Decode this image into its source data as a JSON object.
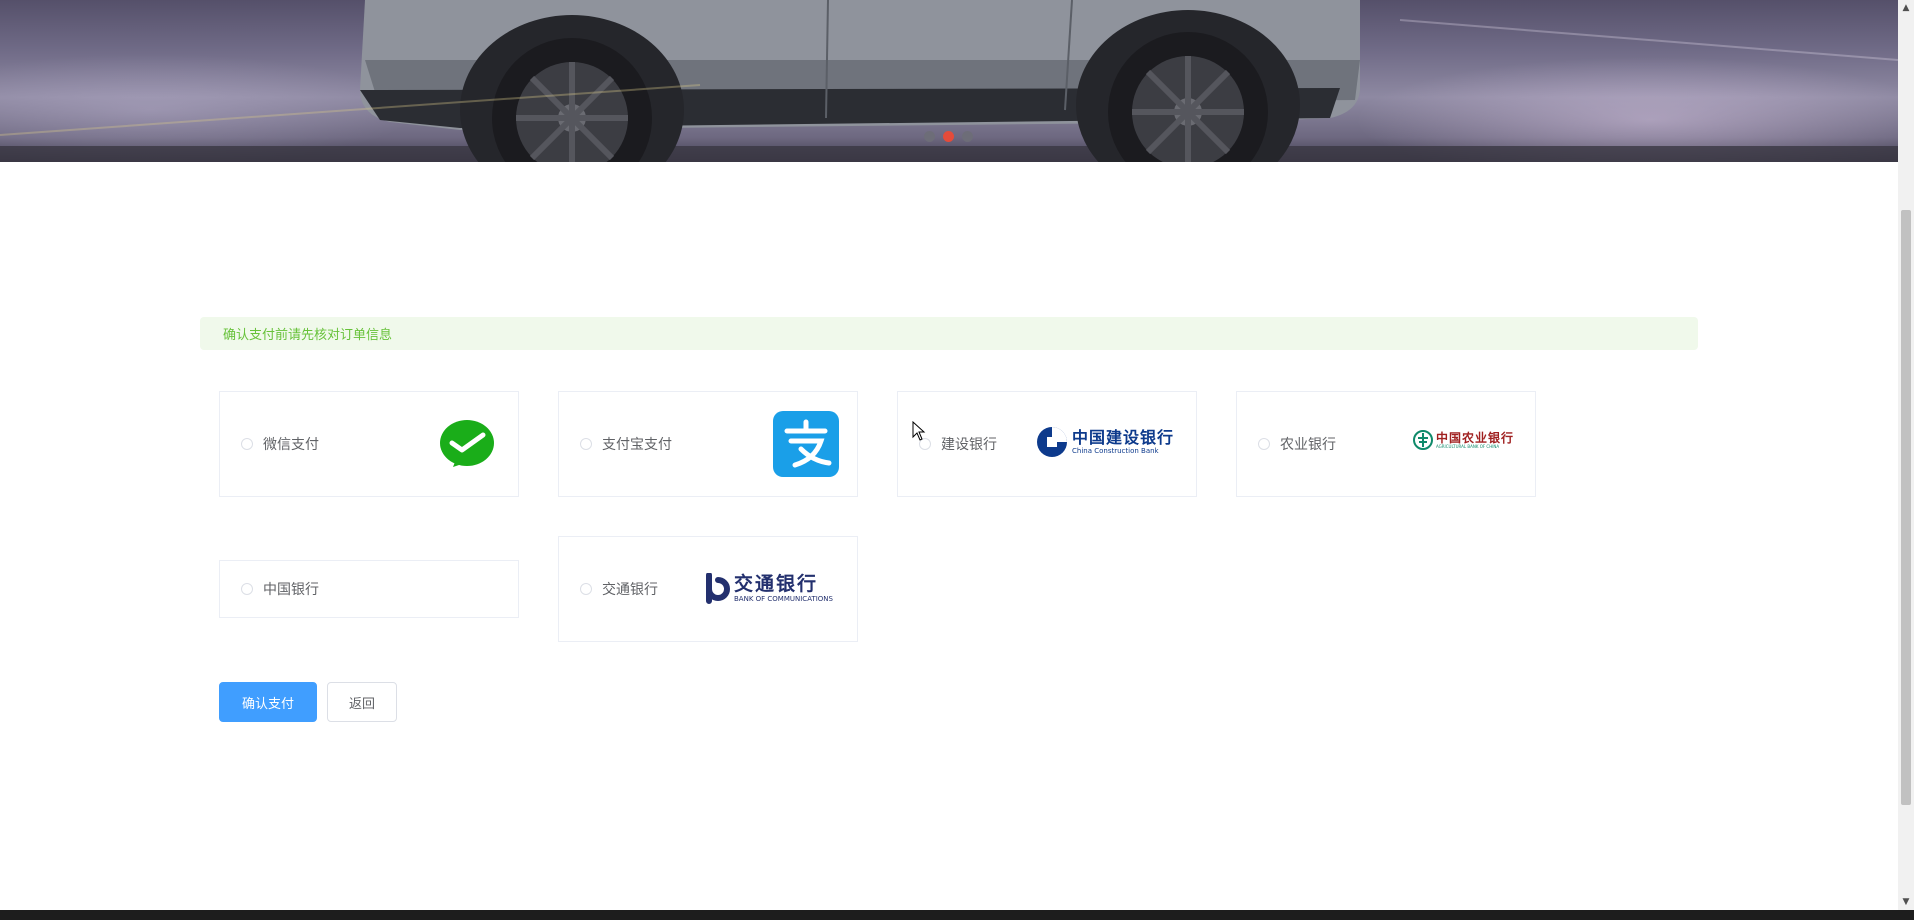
{
  "alert": {
    "text": "确认支付前请先核对订单信息"
  },
  "payment_options": [
    {
      "label": "微信支付",
      "icon": "wechat-pay-icon"
    },
    {
      "label": "支付宝支付",
      "icon": "alipay-icon"
    },
    {
      "label": "建设银行",
      "logo_text": "中国建设银行",
      "logo_subtext": "China Construction Bank"
    },
    {
      "label": "农业银行",
      "logo_text": "中国农业银行",
      "logo_subtext": "AGRICULTURAL BANK OF CHINA"
    },
    {
      "label": "中国银行"
    },
    {
      "label": "交通银行",
      "logo_text": "交通银行",
      "logo_subtext": "BANK OF COMMUNICATIONS"
    }
  ],
  "buttons": {
    "confirm": "确认支付",
    "back": "返回"
  },
  "carousel": {
    "slides": 3,
    "active_index": 1
  },
  "colors": {
    "primary": "#409eff",
    "alert_bg": "#f0f9eb",
    "alert_text": "#67c23a",
    "active_dot": "#e54b3a",
    "wechat_green": "#1aad19",
    "alipay_blue": "#1a9fe8",
    "ccb_blue": "#0d3a8c",
    "abc_green": "#0f8a6a",
    "bocom_blue": "#23306e"
  }
}
